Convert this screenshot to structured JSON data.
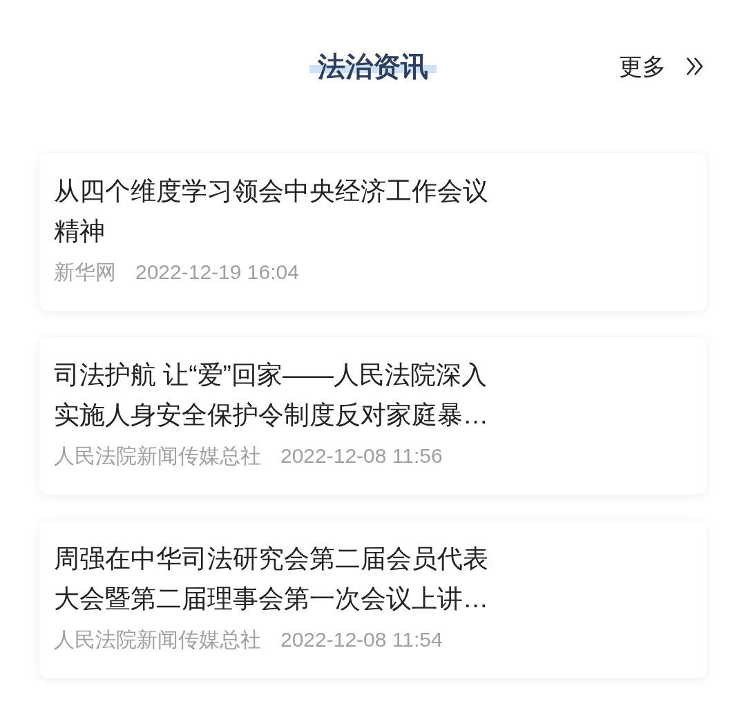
{
  "header": {
    "title": "法治资讯",
    "more": "更多"
  },
  "news": [
    {
      "title": "从四个维度学习领会中央经济工作会议精神",
      "source": "新华网",
      "time": "2022-12-19 16:04"
    },
    {
      "title": "司法护航 让“爱”回家——人民法院深入实施人身安全保护令制度反对家庭暴…",
      "source": "人民法院新闻传媒总社",
      "time": "2022-12-08 11:56"
    },
    {
      "title": "周强在中华司法研究会第二届会员代表大会暨第二届理事会第一次会议上讲…",
      "source": "人民法院新闻传媒总社",
      "time": "2022-12-08 11:54"
    }
  ]
}
